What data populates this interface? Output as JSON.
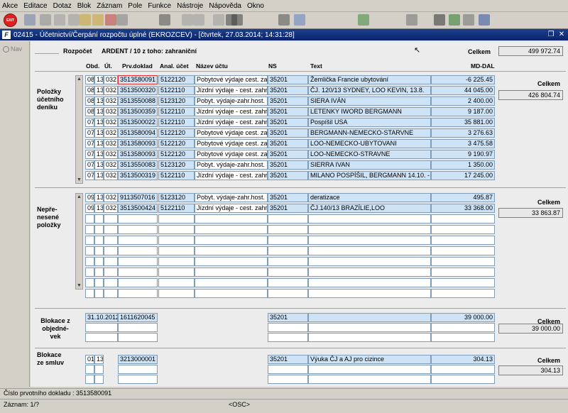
{
  "menu": [
    "Akce",
    "Editace",
    "Dotaz",
    "Blok",
    "Záznam",
    "Pole",
    "Funkce",
    "Nástroje",
    "Nápověda",
    "Okno"
  ],
  "exit_label": "EXIT",
  "title": "02415 - Účetnictví/Čerpání rozpočtu úplné (EKROZCEV) - [čtvrtek, 27.03.2014; 14:31:28]",
  "nav_label": "Nav",
  "header": {
    "rozpocet_label": "Rozpočet",
    "rozpocet_value": "ARDENT / 10 z toho: zahraniční",
    "celkem_label": "Celkem",
    "celkem_value": "499 972.74"
  },
  "columns": {
    "obd": "Obd.",
    "ul": "Úl.",
    "prvdoklad": "Prv.doklad",
    "analucet": "Anal. účet",
    "nazev": "Název účtu",
    "ns": "NS",
    "text": "Text",
    "mddal": "MD-DAL"
  },
  "sections": {
    "polozky": {
      "label": "Položky účetního deníku",
      "celkem_label": "Celkem",
      "celkem_value": "426 804.74",
      "rows": [
        {
          "obd": "08",
          "ul": "13",
          "x": "032",
          "doklad": "3513580091",
          "ucet": "5122120",
          "nazev": "Pobytové výdaje cest. zahr.",
          "ns": "35201",
          "text": "Žemlička Francie ubytování",
          "amount": "-6 225.45"
        },
        {
          "obd": "08",
          "ul": "13",
          "x": "032",
          "doklad": "3513500320",
          "ucet": "5122110",
          "nazev": "Jízdní výdaje - cest. zahr.",
          "ns": "35201",
          "text": "ČJ. 120/13 SYDNEY, LOO KEVIN, 13.8.",
          "amount": "44 045.00"
        },
        {
          "obd": "08",
          "ul": "13",
          "x": "032",
          "doklad": "3513550088",
          "ucet": "5123120",
          "nazev": "Pobyt. výdaje-zahr.host. §",
          "ns": "35201",
          "text": "SIERA IVÁN",
          "amount": "2 400.00"
        },
        {
          "obd": "08",
          "ul": "13",
          "x": "032",
          "doklad": "3513500359",
          "ucet": "5122110",
          "nazev": "Jízdní výdaje - cest. zahr.",
          "ns": "35201",
          "text": "LETENKY IWORD BERGMANN",
          "amount": "9 187.00"
        },
        {
          "obd": "07",
          "ul": "13",
          "x": "032",
          "doklad": "3513500022",
          "ucet": "5122110",
          "nazev": "Jízdní výdaje - cest. zahr.",
          "ns": "35201",
          "text": "Pospíšil USA",
          "amount": "35 881.00"
        },
        {
          "obd": "07",
          "ul": "13",
          "x": "032",
          "doklad": "3513580094",
          "ucet": "5122120",
          "nazev": "Pobytové výdaje cest. zahr.",
          "ns": "35201",
          "text": "BERGMANN-NEMECKO-STARVNE",
          "amount": "3 276.63"
        },
        {
          "obd": "07",
          "ul": "13",
          "x": "032",
          "doklad": "3513580093",
          "ucet": "5122120",
          "nazev": "Pobytové výdaje cest. zahr.",
          "ns": "35201",
          "text": "LOO-NEMECKO-UBYTOVANI",
          "amount": "3 475.58"
        },
        {
          "obd": "07",
          "ul": "13",
          "x": "032",
          "doklad": "3513580093",
          "ucet": "5122120",
          "nazev": "Pobytové výdaje cest. zahr.",
          "ns": "35201",
          "text": "LOO-NEMECKO-STRAVNE",
          "amount": "9 190.97"
        },
        {
          "obd": "07",
          "ul": "13",
          "x": "032",
          "doklad": "3513550083",
          "ucet": "5123120",
          "nazev": "Pobyt. výdaje-zahr.host. §",
          "ns": "35201",
          "text": "SIERRA IVAN",
          "amount": "1 350.00"
        },
        {
          "obd": "07",
          "ul": "13",
          "x": "032",
          "doklad": "3513500319",
          "ucet": "5122110",
          "nazev": "Jízdní výdaje - cest. zahr.",
          "ns": "35201",
          "text": "MILANO POSPÍŠIL, BERGMANN 14.10. -",
          "amount": "17 245.00"
        }
      ]
    },
    "neprenesene": {
      "label": "Nepře-nesené položky",
      "celkem_label": "Celkem",
      "celkem_value": "33 863.87",
      "rows": [
        {
          "obd": "09",
          "ul": "13",
          "x": "032",
          "doklad": "9113507016",
          "ucet": "5123120",
          "nazev": "Pobyt. výdaje-zahr.host. §",
          "ns": "35201",
          "text": "deratizace",
          "amount": "495.87"
        },
        {
          "obd": "09",
          "ul": "13",
          "x": "032",
          "doklad": "3513500424",
          "ucet": "5122110",
          "nazev": "Jízdní výdaje - cest. zahr.",
          "ns": "35201",
          "text": "ČJ.140/13 BRAZÍLIE,LOO",
          "amount": "33 368.00"
        }
      ]
    },
    "blokace_obj": {
      "label": "Blokace z objedné-vek",
      "celkem_label": "Celkem",
      "celkem_value": "39 000.00",
      "row": {
        "date": "31.10.2012",
        "doklad": "1611620045",
        "ns": "35201",
        "text": "",
        "amount": "39 000.00"
      }
    },
    "blokace_sml": {
      "label": "Blokace ze smluv",
      "celkem_label": "Celkem",
      "celkem_value": "304.13",
      "row": {
        "obd": "01",
        "ul": "13",
        "doklad": "3213000001",
        "ns": "35201",
        "text": "Výuka ČJ a AJ pro cizince",
        "amount": "304.13"
      }
    }
  },
  "status": {
    "line1": "Číslo prvotního dokladu : 3513580091",
    "zaznam": "Záznam: 1/?",
    "osc": "<OSC>"
  },
  "colors": {
    "field_blue": "#cfe3f7",
    "titlebar": "#0a246a",
    "background": "#ececec"
  }
}
